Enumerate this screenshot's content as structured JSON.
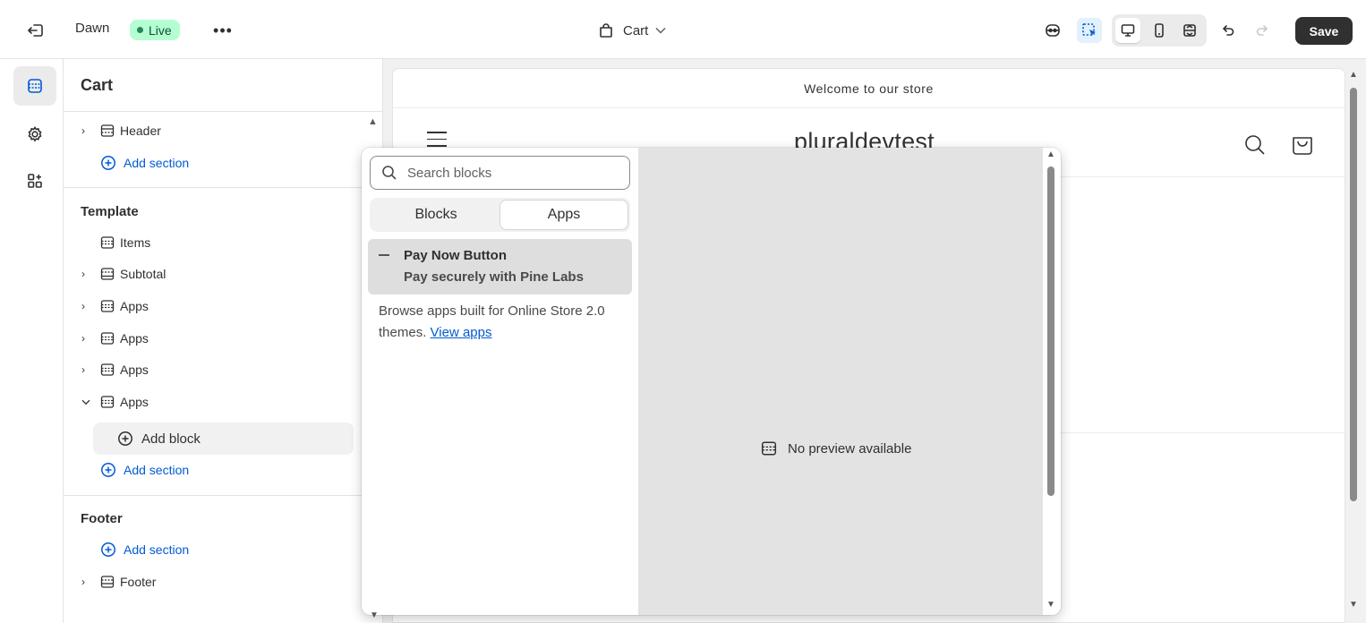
{
  "topbar": {
    "theme_name": "Dawn",
    "live_badge": "Live",
    "more_label": "•••",
    "page_selector": "Cart",
    "save_label": "Save"
  },
  "sidebar": {
    "title": "Cart",
    "header_section": {
      "label": "Header",
      "add_section": "Add section"
    },
    "template": {
      "heading": "Template",
      "items": [
        {
          "label": "Items",
          "expandable": false
        },
        {
          "label": "Subtotal",
          "expandable": true
        },
        {
          "label": "Apps",
          "expandable": true
        },
        {
          "label": "Apps",
          "expandable": true
        },
        {
          "label": "Apps",
          "expandable": true
        },
        {
          "label": "Apps",
          "expandable": true,
          "expanded": true
        }
      ],
      "add_block": "Add block",
      "add_section": "Add section"
    },
    "footer": {
      "heading": "Footer",
      "add_section": "Add section",
      "item": "Footer"
    }
  },
  "preview": {
    "announcement": "Welcome to our store",
    "store_name": "pluraldevtest"
  },
  "popover": {
    "search_placeholder": "Search blocks",
    "tabs": [
      "Blocks",
      "Apps"
    ],
    "active_tab": "Apps",
    "app_block": {
      "name": "Pay Now Button",
      "subtitle": "Pay securely with Pine Labs"
    },
    "browse_text": "Browse apps built for Online Store 2.0 themes.",
    "browse_link": "View apps",
    "no_preview": "No preview available"
  },
  "colors": {
    "accent": "#005bd3",
    "live_badge_bg": "#b4fed2",
    "live_dot": "#29845a",
    "save_bg": "#303030"
  }
}
